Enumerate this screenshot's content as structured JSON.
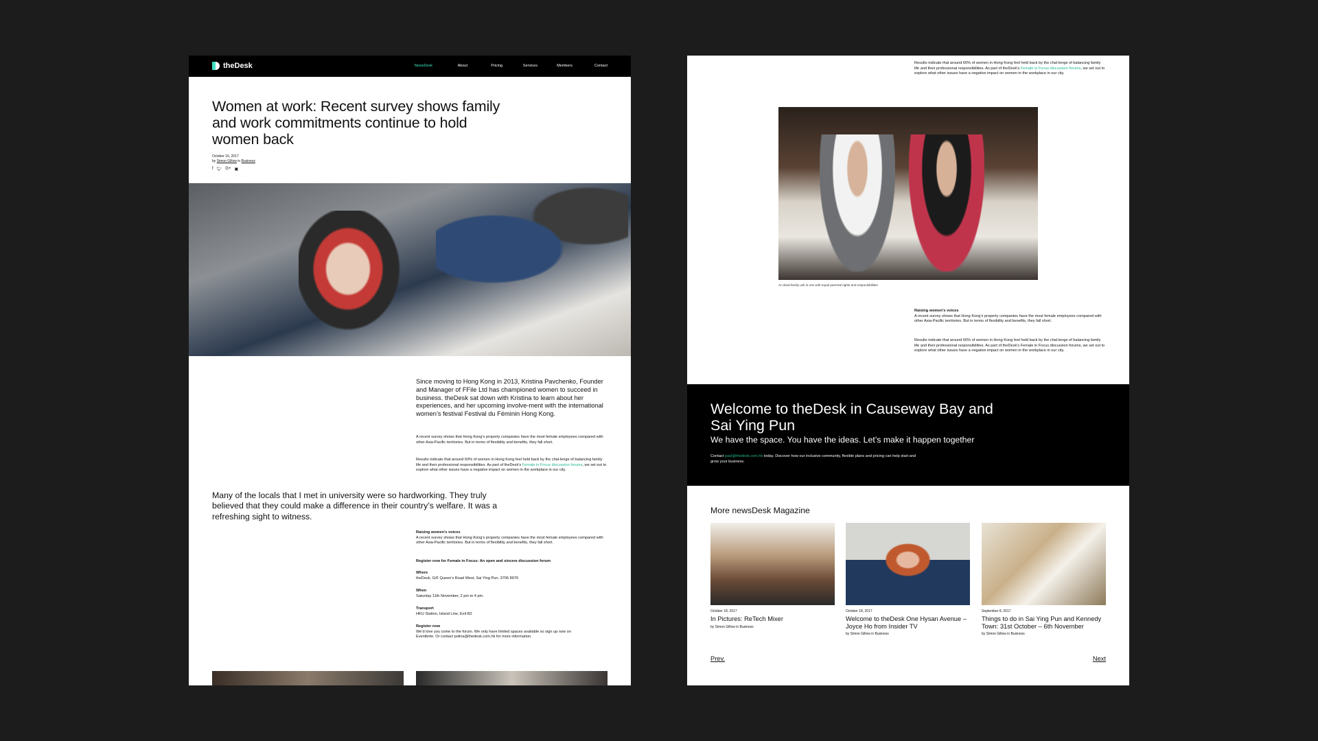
{
  "article": {
    "nav": {
      "brand": "theDesk",
      "links": [
        "NewsDesk",
        "About",
        "Pricing",
        "Services",
        "Members",
        "Contact"
      ],
      "active": "NewsDesk"
    },
    "title": "Women at work: Recent survey shows family and work commitments continue to hold women back",
    "date": "October 16, 2017",
    "byline_prefix": "by",
    "author": "Simon Gillow",
    "byline_in": "in",
    "category": "Business",
    "share_icons": [
      "facebook-icon",
      "twitter-icon",
      "google-plus-icon",
      "linkedin-icon"
    ],
    "lede": "Since moving to Hong Kong in 2013, Kristina Pavchenko, Founder and Manager of FFile Ltd has championed women to succeed in business. theDesk sat down with Kristina to learn about her experiences, and her upcoming involve-ment with the international women’s festival Festival du Féminin Hong Kong.",
    "para1": "A recent survey shows that Hong Kong’s property companies have the most female employees compared with other Asia-Pacific territories. But in terms of flexibility and benefits, they fall short.",
    "para2_start": "Results indicate that around 60% of women in Hong Kong feel held back by the chal-lenge of balancing family life and their professional responsibilities. As part of theDesk’s",
    "para2_link": "Female in Focus discussion forums",
    "para2_end": ", we set out to explore what other issues have a negative impact on women in the workplace in our city.",
    "quote": "Many of the locals that I met in university were so hardworking. They truly believed that they could make a difference in their country’s welfare. It was a refreshing sight to witness.",
    "voices_heading": "Raising women’s voices",
    "voices_text": "A recent survey shows that Hong Kong’s property companies have the most female employees compared with other Asia-Pacific territories. But in terms of flexibility and benefits, they fall short.",
    "register_heading": "Register now for Female in Focus: An open and sincere discussion forum",
    "where_label": "Where",
    "where_text": "theDesk, G/F Queen’s Road West, Sai Ying Pun. 3706 8976",
    "when_label": "When",
    "when_text": "Saturday 11th November, 2 pm to 4 pm.",
    "transport_label": "Transport",
    "transport_text": "HKU Station, Island Line, Exit B2",
    "register_label": "Register now",
    "register_text": "We’d love you come to the forum. We only have limited spaces available so sign up now on Eventbrite. Or contact polina@thedesk.com.hk for more information."
  },
  "right": {
    "top_para_start": "Results indicate that around 60% of women in Hong Kong feel held back by the chal-lenge of balancing family life and their professional responsibilities. As part of theDesk’s",
    "top_para_link": "Female in Focus discussion forums",
    "top_para_end": ", we set out to explore what other issues have a negative impact on women in the workplace in our city.",
    "caption": "An ideal family unit is one with equal parental rights and responsibilities",
    "voices_heading": "Raising women’s voices",
    "voices_text": "A recent survey shows that Hong Kong’s property companies have the most female employees compared with other Asia-Pacific territories. But in terms of flexibility and benefits, they fall short.",
    "results_text": "Results indicate that around 60% of women in Hong Kong feel held back by the chal-lenge of balancing family life and their professional responsibilities. As part of theDesk’s Female in Focus discussion forums, we set out to explore what other issues have a negative impact on women in the workplace in our city.",
    "promo_title": "Welcome to theDesk in Causeway Bay and Sai Ying Pun",
    "promo_sub": "We have the space. You have the ideas. Let’s make it happen together",
    "promo_contact_prefix": "Contact",
    "promo_contact_email": "paul@thedesk.com.hk",
    "promo_contact_rest": "today. Discover how our inclusive community, flexible plans and pricing can help start and grow your business.",
    "more_heading": "More newsDesk Magazine",
    "cards": [
      {
        "date": "October 18, 2017",
        "title": "In Pictures: ReTech Mixer",
        "byline": "by Simon Gillow in Business"
      },
      {
        "date": "October 18, 2017",
        "title": "Welcome to theDesk One Hysan Avenue – Joyce Ho from Insider TV",
        "byline": "by Simon Gillow in Business"
      },
      {
        "date": "September 8, 2017",
        "title": "Things to do in Sai Ying Pun and Kennedy Town: 31st October – 6th November",
        "byline": "by Simon Gillow in Business"
      }
    ],
    "prev": "Prev.",
    "next": "Next"
  }
}
